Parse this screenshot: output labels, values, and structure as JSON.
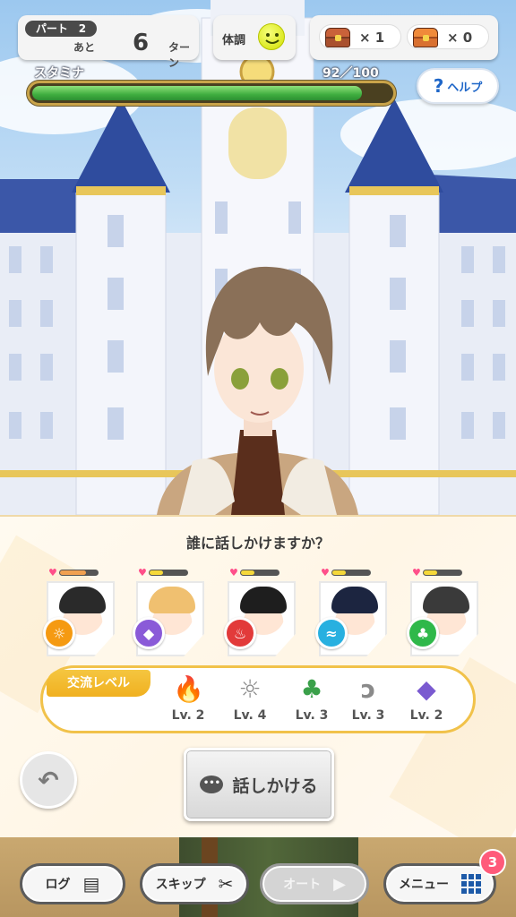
{
  "hud": {
    "part_label": "パート",
    "part_number": "2",
    "remaining_prefix": "あと",
    "remaining_turns": "6",
    "turn_suffix": "ターン",
    "condition_label": "体調",
    "condition_icon": "smile-face-icon",
    "chest_red_count": "× 1",
    "chest_gold_count": "× 0",
    "stamina_label": "スタミナ",
    "stamina_value": "92／100",
    "stamina_fraction": 0.92,
    "help_label": "ヘルプ"
  },
  "dialog": {
    "question": "誰に話しかけますか？",
    "characters": [
      {
        "name_icon": "character-1",
        "attribute_icon": "sun-icon",
        "attribute_color": "#f59a12",
        "bar_color": "#f0a050",
        "affinity": 0.7,
        "hair_color": "#2a2a2a"
      },
      {
        "name_icon": "character-2",
        "attribute_icon": "diamond-icon",
        "attribute_color": "#8a5ad8",
        "bar_color": "#f5d83a",
        "affinity": 0.35,
        "hair_color": "#f0c070"
      },
      {
        "name_icon": "character-3",
        "attribute_icon": "flame-icon",
        "attribute_color": "#e23a3a",
        "bar_color": "#f5d83a",
        "affinity": 0.35,
        "hair_color": "#1e1e1e"
      },
      {
        "name_icon": "character-4",
        "attribute_icon": "wind-icon",
        "attribute_color": "#28b0e0",
        "bar_color": "#f5d83a",
        "affinity": 0.35,
        "hair_color": "#1c2540"
      },
      {
        "name_icon": "character-5",
        "attribute_icon": "clover-icon",
        "attribute_color": "#2fb84a",
        "bar_color": "#f5d83a",
        "affinity": 0.35,
        "hair_color": "#3a3a3a"
      }
    ],
    "level_tag": "交流レベル",
    "levels": [
      {
        "icon": "flame-icon",
        "glyph": "🔥",
        "color": "#e23a3a",
        "label": "Lv. 2"
      },
      {
        "icon": "sun-icon",
        "glyph": "☼",
        "color": "#8a8a8a",
        "label": "Lv. 4"
      },
      {
        "icon": "clover-icon",
        "glyph": "♣",
        "color": "#3aa04a",
        "label": "Lv. 3"
      },
      {
        "icon": "wind-icon",
        "glyph": "ↄ",
        "color": "#8a8a8a",
        "label": "Lv. 3"
      },
      {
        "icon": "diamond-icon",
        "glyph": "◆",
        "color": "#7a5ad0",
        "label": "Lv. 2"
      }
    ],
    "talk_button": "話しかける"
  },
  "footer": {
    "log_label": "ログ",
    "skip_label": "スキップ",
    "auto_label": "オート",
    "menu_label": "メニュー",
    "menu_badge": "3"
  }
}
